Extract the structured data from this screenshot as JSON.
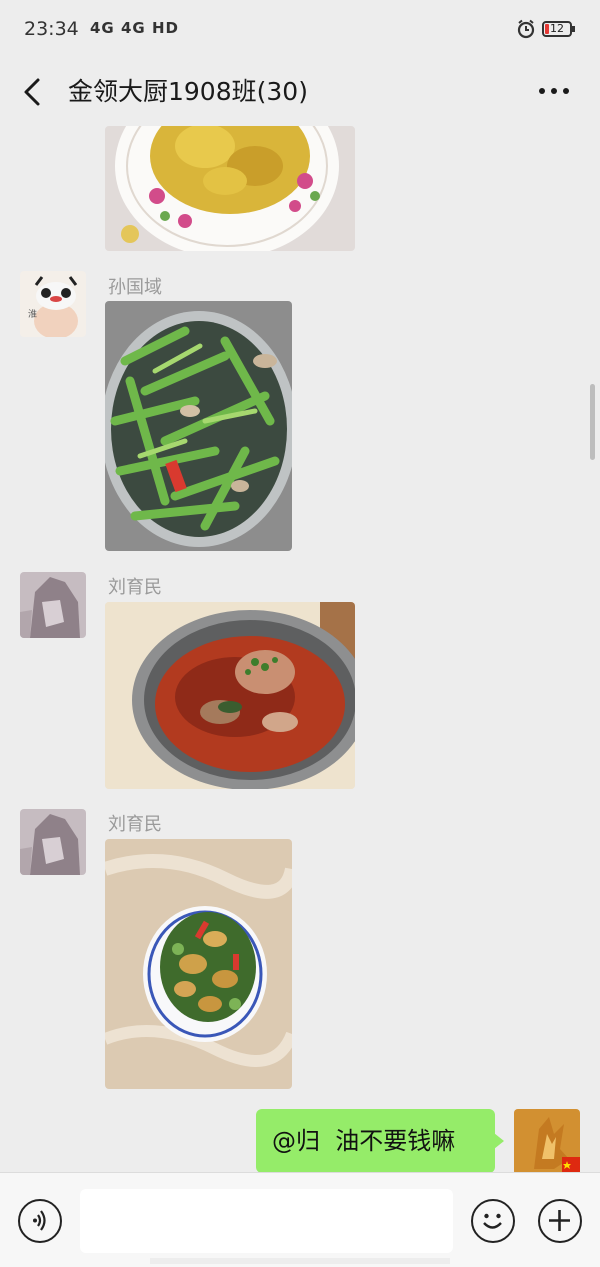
{
  "status_bar": {
    "time": "23:34",
    "network": "4G 4G HD",
    "battery": "12"
  },
  "nav": {
    "title": "金领大厨1908班(30)"
  },
  "messages": [
    {
      "sender": "孙国域",
      "type": "image",
      "content": "stir-fried garlic scapes with meat"
    },
    {
      "sender": "刘育民",
      "type": "image",
      "content": "spicy dish in red oil in a steel bowl"
    },
    {
      "sender": "刘育民",
      "type": "image",
      "content": "stir-fried vegetables on a floral plate"
    },
    {
      "sender": "me",
      "type": "text",
      "content": "@归  油不要钱嘛"
    }
  ],
  "colors": {
    "background": "#ededed",
    "bubble_self": "#95ec69",
    "battery_low": "#e53935"
  },
  "icons": {
    "back": "chevron-left-icon",
    "more": "more-dots-icon",
    "voice": "voice-icon",
    "emoji": "emoji-icon",
    "add": "plus-icon"
  }
}
